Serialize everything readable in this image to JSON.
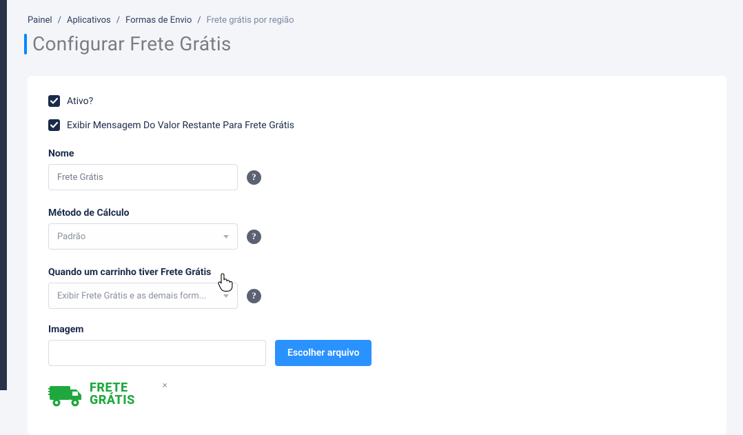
{
  "breadcrumb": {
    "items": [
      "Painel",
      "Aplicativos",
      "Formas de Envio",
      "Frete grátis por região"
    ]
  },
  "page_title": "Configurar Frete Grátis",
  "checkboxes": {
    "active_label": "Ativo?",
    "show_message_label": "Exibir Mensagem Do Valor Restante Para Frete Grátis"
  },
  "fields": {
    "name": {
      "label": "Nome",
      "value": "Frete Grátis"
    },
    "method": {
      "label": "Método de Cálculo",
      "value": "Padrão"
    },
    "when_cart": {
      "label": "Quando um carrinho tiver Frete Grátis",
      "value": "Exibir Frete Grátis e as demais form..."
    },
    "image": {
      "label": "Imagem",
      "button": "Escolher arquivo"
    }
  },
  "thumb": {
    "line1": "FRETE",
    "line2": "GRÁTIS"
  },
  "help_glyph": "?"
}
